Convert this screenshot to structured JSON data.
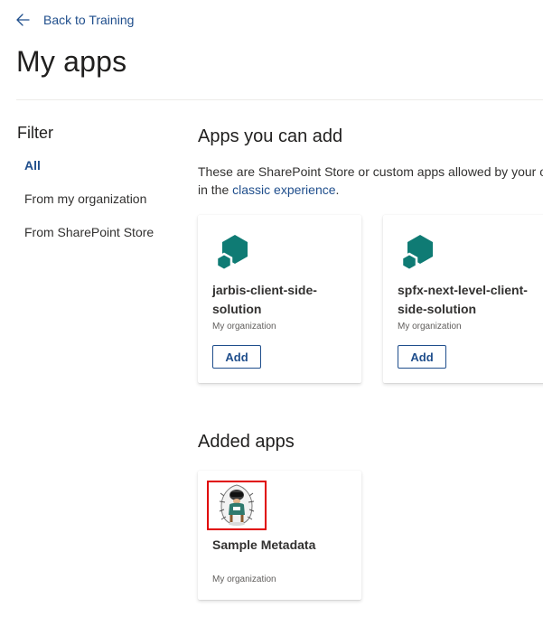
{
  "nav": {
    "back_label": "Back to Training"
  },
  "page": {
    "title": "My apps"
  },
  "filter": {
    "heading": "Filter",
    "items": [
      {
        "label": "All",
        "active": true
      },
      {
        "label": "From my organization",
        "active": false
      },
      {
        "label": "From SharePoint Store",
        "active": false
      }
    ]
  },
  "apps_you_can_add": {
    "heading": "Apps you can add",
    "desc_line1": "These are SharePoint Store or custom apps allowed by your or",
    "desc_line2_prefix": "in the ",
    "desc_link": "classic experience",
    "desc_line2_suffix": ".",
    "cards": [
      {
        "icon": "hexagon-app-icon",
        "title": "jarbis-client-side-solution",
        "source": "My organization",
        "button": "Add"
      },
      {
        "icon": "hexagon-app-icon",
        "title": "spfx-next-level-client-side-solution",
        "source": "My organization",
        "button": "Add"
      }
    ]
  },
  "added_apps": {
    "heading": "Added apps",
    "cards": [
      {
        "icon": "mascot-logo-icon",
        "title": "Sample Metadata",
        "source": "My organization"
      }
    ]
  },
  "colors": {
    "accent": "#1f4e8c",
    "app_icon": "#0f7b74",
    "highlight": "#e00000"
  }
}
